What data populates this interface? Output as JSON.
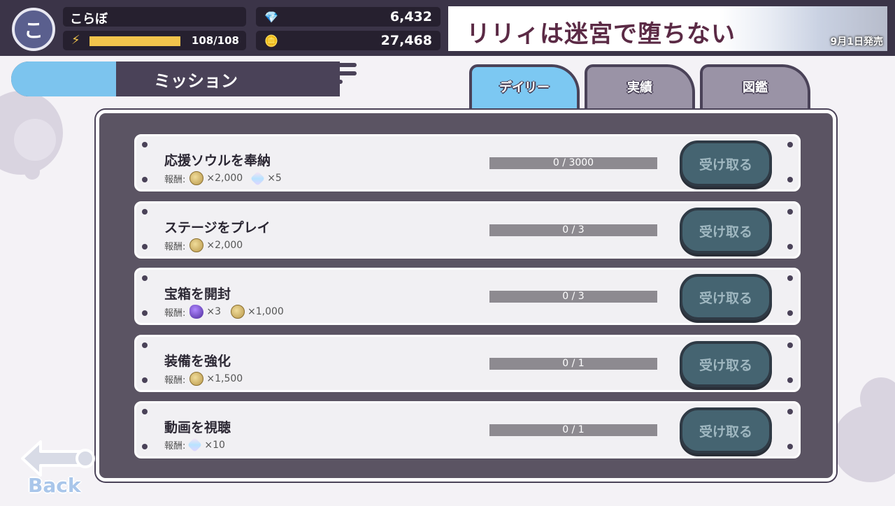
{
  "player": {
    "avatar_initial": "こ",
    "name": "こらぼ",
    "stamina": "108/108",
    "stamina_fraction": 1.0
  },
  "currency": {
    "gems": "6,432",
    "coins": "27,468"
  },
  "banner": {
    "title": "リリィは迷宮で堕ちない",
    "date": "9月1日発売"
  },
  "section_title": "ミッション",
  "tabs": [
    {
      "label": "デイリー",
      "active": true
    },
    {
      "label": "実績",
      "active": false
    },
    {
      "label": "図鑑",
      "active": false
    }
  ],
  "reward_label": "報酬:",
  "missions": [
    {
      "name": "応援ソウルを奉納",
      "rewards": [
        {
          "icon": "coin-icon",
          "amount": "×2,000"
        },
        {
          "icon": "gem-icon",
          "amount": "×5"
        }
      ],
      "progress": "0 / 3000",
      "claim": "受け取る"
    },
    {
      "name": "ステージをプレイ",
      "rewards": [
        {
          "icon": "coin-icon",
          "amount": "×2,000"
        }
      ],
      "progress": "0 / 3",
      "claim": "受け取る"
    },
    {
      "name": "宝箱を開封",
      "rewards": [
        {
          "icon": "ore-icon",
          "amount": "×3"
        },
        {
          "icon": "coin-icon",
          "amount": "×1,000"
        }
      ],
      "progress": "0 / 3",
      "claim": "受け取る"
    },
    {
      "name": "装備を強化",
      "rewards": [
        {
          "icon": "coin-icon",
          "amount": "×1,500"
        }
      ],
      "progress": "0 / 1",
      "claim": "受け取る"
    },
    {
      "name": "動画を視聴",
      "rewards": [
        {
          "icon": "gem-icon",
          "amount": "×10"
        }
      ],
      "progress": "0 / 1",
      "claim": "受け取る"
    }
  ],
  "back_label": "Back",
  "colors": {
    "topbar": "#3b3448",
    "accent_blue": "#7cc4ee",
    "panel": "#5b5463",
    "claim_button": "#456471"
  }
}
